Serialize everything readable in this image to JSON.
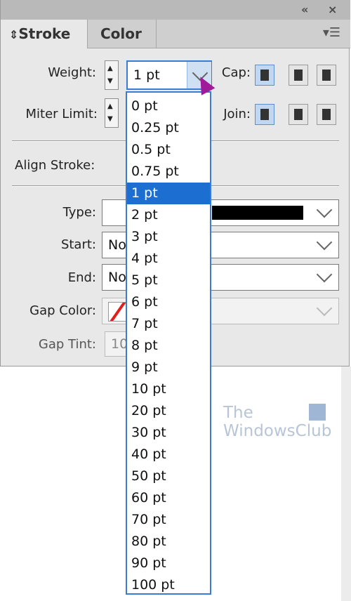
{
  "panel": {
    "tabs": [
      {
        "label": "Stroke"
      },
      {
        "label": "Color"
      }
    ],
    "weight_label": "Weight:",
    "weight_value": "1 pt",
    "miter_label": "Miter Limit:",
    "cap_label": "Cap:",
    "join_label": "Join:",
    "align_label": "Align Stroke:",
    "type_label": "Type:",
    "start_label": "Start:",
    "start_value": "No",
    "end_label": "End:",
    "end_value": "No",
    "gap_color_label": "Gap Color:",
    "gap_tint_label": "Gap Tint:",
    "gap_tint_value": "10"
  },
  "dropdown": {
    "selected": "1 pt",
    "items": [
      "0 pt",
      "0.25 pt",
      "0.5 pt",
      "0.75 pt",
      "1 pt",
      "2 pt",
      "3 pt",
      "4 pt",
      "5 pt",
      "6 pt",
      "7 pt",
      "8 pt",
      "9 pt",
      "10 pt",
      "20 pt",
      "30 pt",
      "40 pt",
      "50 pt",
      "60 pt",
      "70 pt",
      "80 pt",
      "90 pt",
      "100 pt"
    ]
  },
  "watermark": {
    "line1": "The",
    "line2": "WindowsClub"
  },
  "colors": {
    "highlight": "#1c6fd1",
    "focus_border": "#3a7bd5",
    "cursor": "#a01a9a",
    "gap_swatch": "#e0201e"
  }
}
